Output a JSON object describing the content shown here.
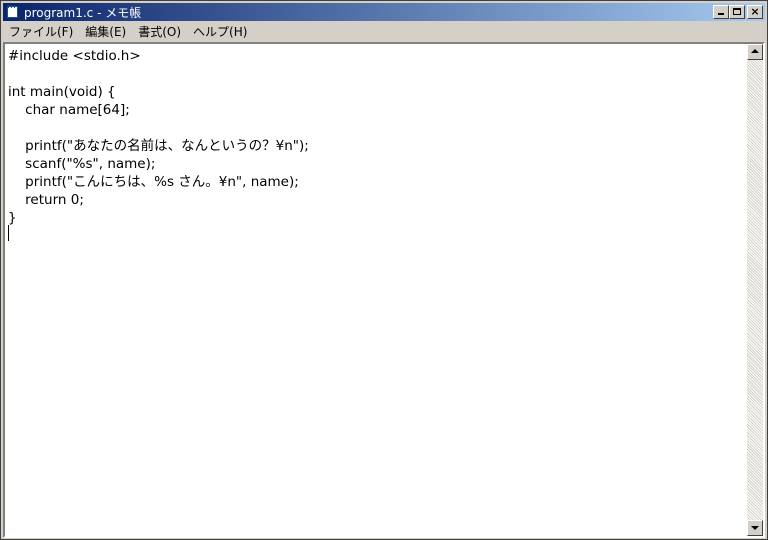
{
  "window": {
    "title": "program1.c - メモ帳",
    "title_bar_color": "#0a246a"
  },
  "menu": {
    "items": [
      {
        "label": "ファイル(F)"
      },
      {
        "label": "編集(E)"
      },
      {
        "label": "書式(O)"
      },
      {
        "label": "ヘルプ(H)"
      }
    ]
  },
  "editor": {
    "lines": [
      "#include <stdio.h>",
      "",
      "int main(void) {",
      "    char name[64];",
      "",
      "    printf(\"あなたの名前は、なんというの？¥n\");",
      "    scanf(\"%s\", name);",
      "    printf(\"こんにちは、%s さん。¥n\", name);",
      "    return 0;",
      "}"
    ]
  },
  "controls": {
    "close_glyph": "×"
  }
}
